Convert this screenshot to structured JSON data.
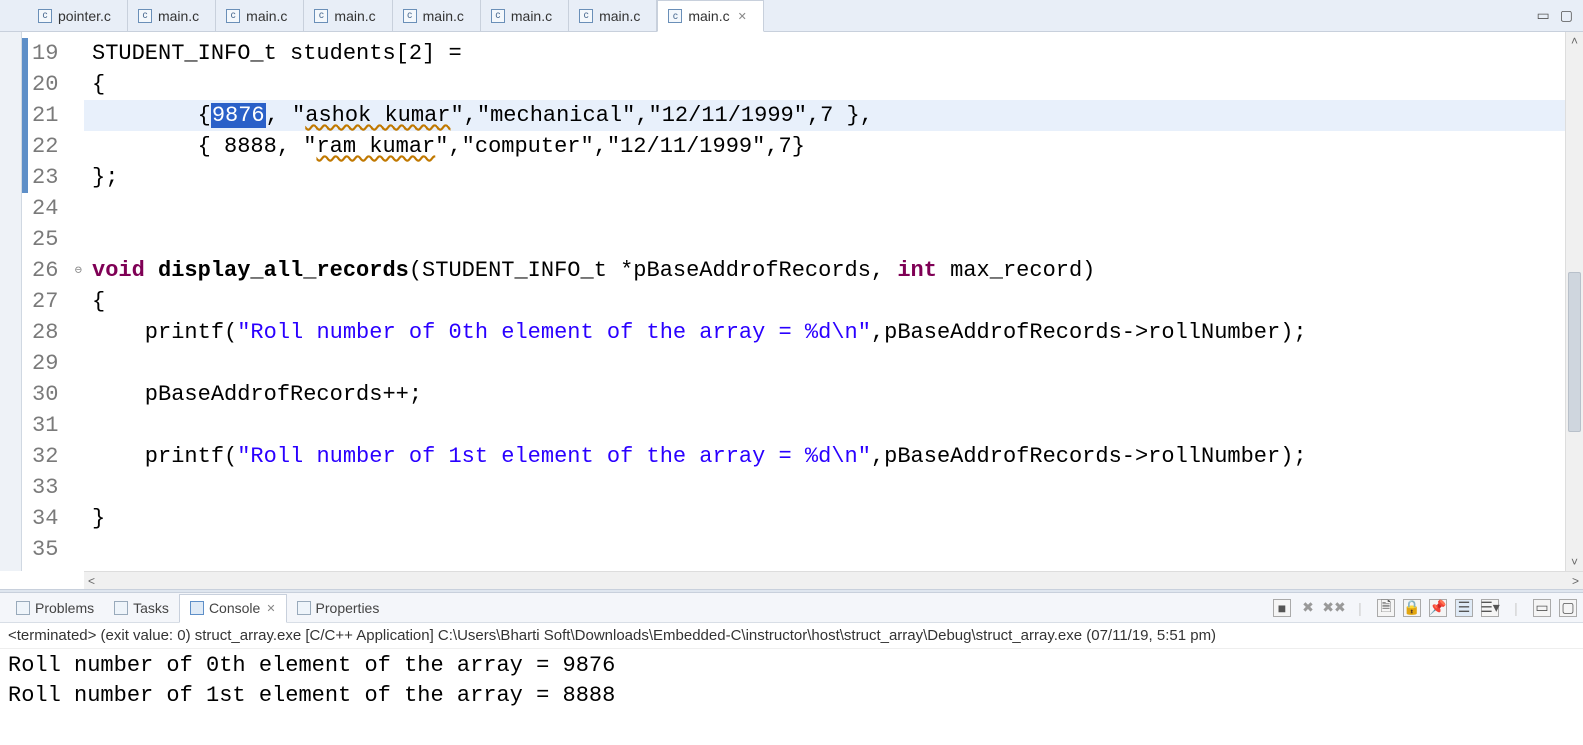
{
  "tabs": [
    {
      "label": "pointer.c",
      "active": false
    },
    {
      "label": "main.c",
      "active": false
    },
    {
      "label": "main.c",
      "active": false
    },
    {
      "label": "main.c",
      "active": false
    },
    {
      "label": "main.c",
      "active": false
    },
    {
      "label": "main.c",
      "active": false
    },
    {
      "label": "main.c",
      "active": false
    },
    {
      "label": "main.c",
      "active": true
    }
  ],
  "code": {
    "first_line": 19,
    "selected_text": "9876",
    "lines": {
      "l19": "STUDENT_INFO_t students[2] =",
      "l20": "{",
      "l21_pre": "        {",
      "l21_post": ", \"",
      "l21_name": "ashok kumar",
      "l21_tail": "\",\"mechanical\",\"12/11/1999\",7 },",
      "l22_pre": "        { 8888, \"",
      "l22_name": "ram kumar",
      "l22_tail": "\",\"computer\",\"12/11/1999\",7}",
      "l23": "};",
      "l24": "",
      "l25": "",
      "l26_kw": "void ",
      "l26_fn": "display_all_records",
      "l26_rest": "(STUDENT_INFO_t *pBaseAddrofRecords, ",
      "l26_kw2": "int",
      "l26_rest2": " max_record)",
      "l27": "{",
      "l28_a": "    printf(",
      "l28_s": "\"Roll number of 0th element of the array = %d\\n\"",
      "l28_b": ",pBaseAddrofRecords->rollNumber);",
      "l29": "",
      "l30": "    pBaseAddrofRecords++;",
      "l31": "",
      "l32_a": "    printf(",
      "l32_s": "\"Roll number of 1st element of the array = %d\\n\"",
      "l32_b": ",pBaseAddrofRecords->rollNumber);",
      "l33": "",
      "l34": "}",
      "l35": ""
    },
    "gutter": [
      "19",
      "20",
      "21",
      "22",
      "23",
      "24",
      "25",
      "26",
      "27",
      "28",
      "29",
      "30",
      "31",
      "32",
      "33",
      "34",
      "35"
    ]
  },
  "bottom_tabs": {
    "problems": "Problems",
    "tasks": "Tasks",
    "console": "Console",
    "properties": "Properties"
  },
  "terminated": "<terminated> (exit value: 0) struct_array.exe [C/C++ Application] C:\\Users\\Bharti Soft\\Downloads\\Embedded-C\\instructor\\host\\struct_array\\Debug\\struct_array.exe (07/11/19, 5:51 pm)",
  "console": {
    "l1": "Roll number of 0th element of the array = 9876",
    "l2": "Roll number of 1st element of the array = 8888"
  }
}
